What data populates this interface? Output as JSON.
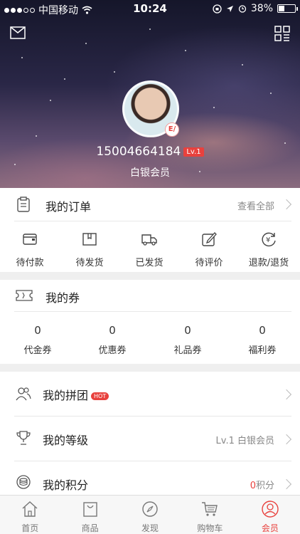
{
  "status_bar": {
    "carrier": "中国移动",
    "time": "10:24",
    "battery": "38%",
    "battery_level": 0.38
  },
  "profile": {
    "phone": "15004664184",
    "level": "Lv.1",
    "member_title": "白银会员",
    "badge": "E/"
  },
  "orders": {
    "title": "我的订单",
    "view_all": "查看全部",
    "items": [
      {
        "label": "待付款",
        "icon": "wallet-icon"
      },
      {
        "label": "待发货",
        "icon": "package-icon"
      },
      {
        "label": "已发货",
        "icon": "truck-icon"
      },
      {
        "label": "待评价",
        "icon": "edit-icon"
      },
      {
        "label": "退款/退货",
        "icon": "refund-icon"
      }
    ]
  },
  "coupons": {
    "title": "我的券",
    "items": [
      {
        "value": "0",
        "label": "代金券"
      },
      {
        "value": "0",
        "label": "优惠券"
      },
      {
        "value": "0",
        "label": "礼品券"
      },
      {
        "value": "0",
        "label": "福利券"
      }
    ]
  },
  "menu": {
    "group_buy": {
      "label": "我的拼团",
      "tag": "HOT"
    },
    "level": {
      "label": "我的等级",
      "value": "Lv.1 白银会员"
    },
    "points": {
      "label": "我的积分",
      "value_num": "0",
      "value_unit": "积分"
    }
  },
  "tabbar": {
    "items": [
      {
        "label": "首页",
        "icon": "home-icon"
      },
      {
        "label": "商品",
        "icon": "bag-icon"
      },
      {
        "label": "发现",
        "icon": "compass-icon"
      },
      {
        "label": "购物车",
        "icon": "cart-icon"
      },
      {
        "label": "会员",
        "icon": "user-icon"
      }
    ],
    "active": "会员"
  },
  "colors": {
    "accent": "#e8413d"
  }
}
